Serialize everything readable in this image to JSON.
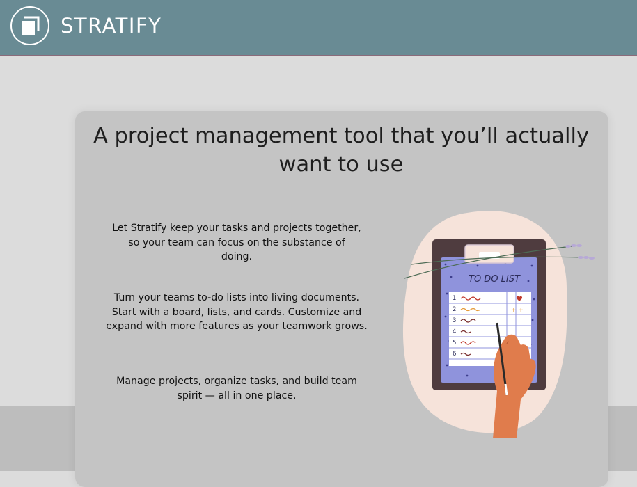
{
  "header": {
    "brand": "STRATIFY",
    "logo_icon": "stratify-logo-icon",
    "background_color": "#698b94"
  },
  "hero": {
    "title": "A project management tool that you’ll actually want to use",
    "paragraphs": [
      "Let Stratify keep your tasks and projects together, so your team can focus on the substance of doing.",
      "Turn your teams to-do lists into living documents. Start with a board, lists, and cards. Customize and expand with more features as your teamwork grows.",
      "Manage projects, organize tasks, and build team spirit — all in one place."
    ]
  },
  "illustration": {
    "name": "todo-clipboard-illustration",
    "heading": "TO DO LIST",
    "row_numbers": [
      "1",
      "2",
      "3",
      "4",
      "5",
      "6"
    ]
  }
}
